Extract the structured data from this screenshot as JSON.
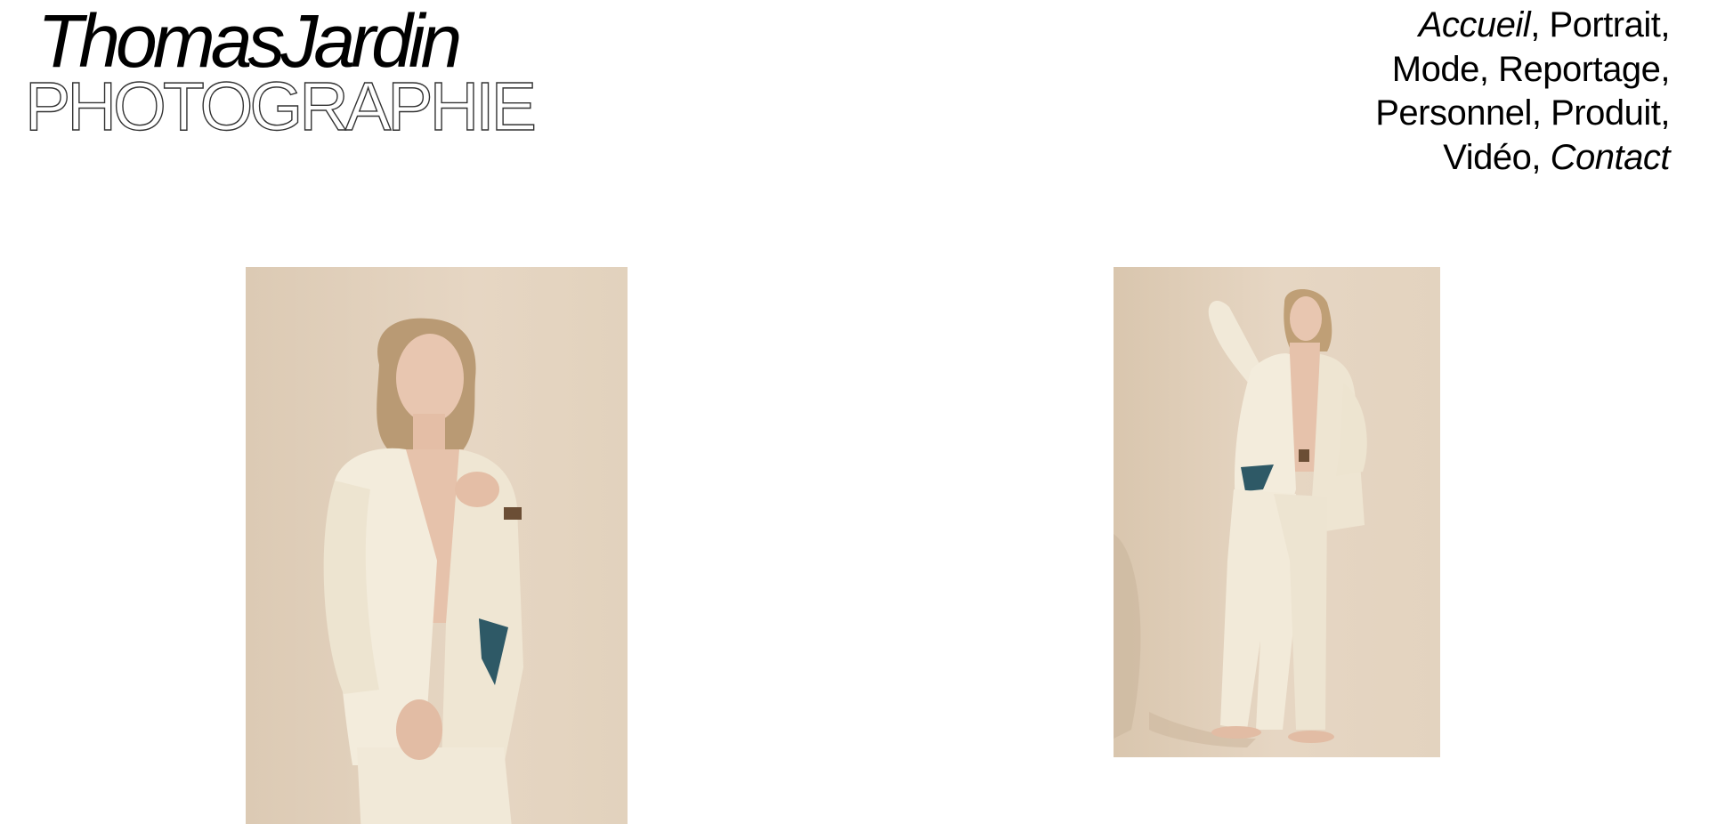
{
  "header": {
    "logo_name": "ThomasJardin",
    "logo_subtitle": "PHOTOGRAPHIE"
  },
  "nav": {
    "items": [
      {
        "label": "Accueil",
        "italic": true
      },
      {
        "label": "Portrait",
        "italic": false
      },
      {
        "label": "Mode",
        "italic": false
      },
      {
        "label": "Reportage",
        "italic": false
      },
      {
        "label": "Personnel",
        "italic": false
      },
      {
        "label": "Produit",
        "italic": false
      },
      {
        "label": "Vidéo",
        "italic": false
      },
      {
        "label": "Contact",
        "italic": true
      }
    ],
    "separator": ","
  },
  "gallery": {
    "images": [
      {
        "subject": "model in cream suit, close crop",
        "background_color": "#e4d4c0"
      },
      {
        "subject": "model in cream suit, full length, barefoot",
        "background_color": "#e4d4c0"
      }
    ]
  },
  "colors": {
    "background": "#ffffff",
    "text": "#000000",
    "suit": "#f3ecdc"
  }
}
